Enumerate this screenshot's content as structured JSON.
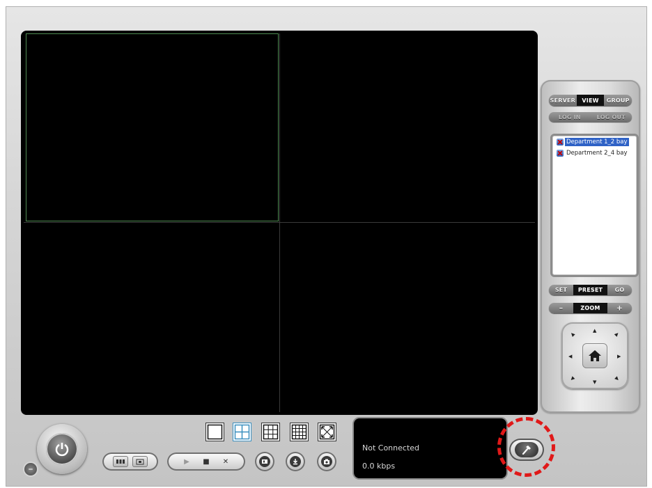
{
  "panel": {
    "tabs": [
      {
        "label": "SERVER",
        "active": false
      },
      {
        "label": "VIEW",
        "active": true
      },
      {
        "label": "GROUP",
        "active": false
      }
    ],
    "auth": {
      "login_label": "LOG IN",
      "logout_label": "LOG OUT"
    },
    "view_list": [
      {
        "label": "Department 1_2 bay",
        "selected": true
      },
      {
        "label": "Department 2_4 bay",
        "selected": false
      }
    ],
    "preset": {
      "set_label": "SET",
      "preset_label": "PRESET",
      "go_label": "GO"
    },
    "zoom": {
      "minus_label": "–",
      "zoom_label": "ZOOM",
      "plus_label": "+"
    }
  },
  "status": {
    "connection": "Not Connected",
    "bitrate": "0.0 kbps"
  },
  "icons": {
    "power": "power-icon",
    "minimize": "minimize-icon",
    "config": "hammer-icon",
    "home": "home-icon"
  },
  "colors": {
    "selected_cell_border": "#4f8b52",
    "list_selection": "#2f62c6",
    "highlight_ring": "#e01919"
  }
}
